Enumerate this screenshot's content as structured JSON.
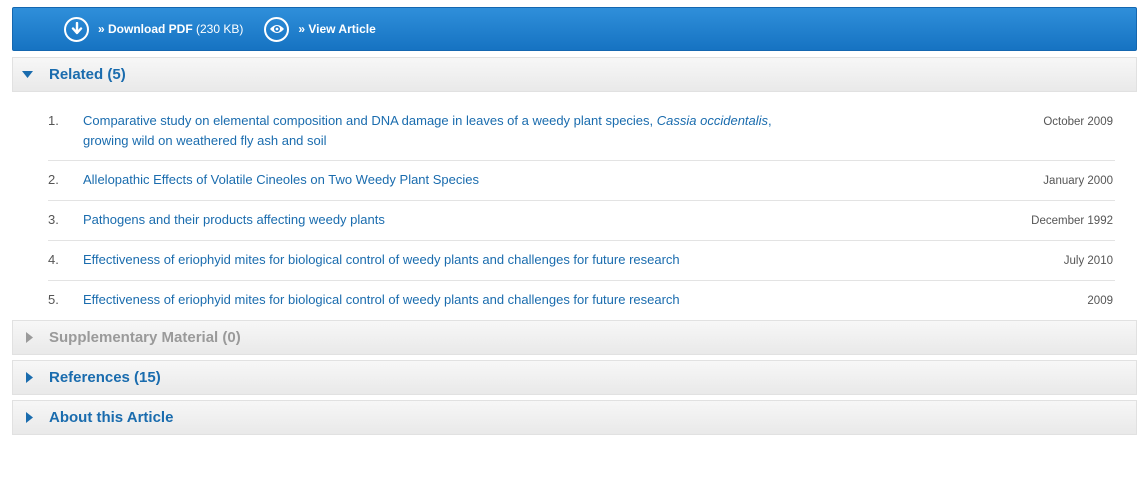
{
  "toolbar": {
    "download_label": "» Download PDF",
    "download_size": "(230 KB)",
    "view_label": "» View Article"
  },
  "sections": {
    "related": {
      "title": "Related (5)",
      "items": [
        {
          "num": "1.",
          "title_pre": "Comparative study on elemental composition and DNA damage in leaves of a weedy plant species, ",
          "title_italic": "Cassia occidentalis",
          "title_post": ",",
          "title_line2": "growing wild on weathered fly ash and soil",
          "date": "October 2009"
        },
        {
          "num": "2.",
          "title": "Allelopathic Effects of Volatile Cineoles on Two Weedy Plant Species",
          "date": "January 2000"
        },
        {
          "num": "3.",
          "title": "Pathogens and their products affecting weedy plants",
          "date": "December 1992"
        },
        {
          "num": "4.",
          "title": "Effectiveness of eriophyid mites for biological control of weedy plants and challenges for future research",
          "date": "July 2010"
        },
        {
          "num": "5.",
          "title": "Effectiveness of eriophyid mites for biological control of weedy plants and challenges for future research",
          "date": "2009"
        }
      ]
    },
    "supplementary": {
      "title": "Supplementary Material (0)"
    },
    "references": {
      "title": "References (15)"
    },
    "about": {
      "title": "About this Article"
    }
  },
  "colors": {
    "toolbar": "#1a78c8",
    "link": "#1a6cae",
    "disabled": "#9a9a9a"
  },
  "icons": [
    "download-icon",
    "view-eye-icon",
    "caret-down-icon",
    "caret-right-icon"
  ]
}
